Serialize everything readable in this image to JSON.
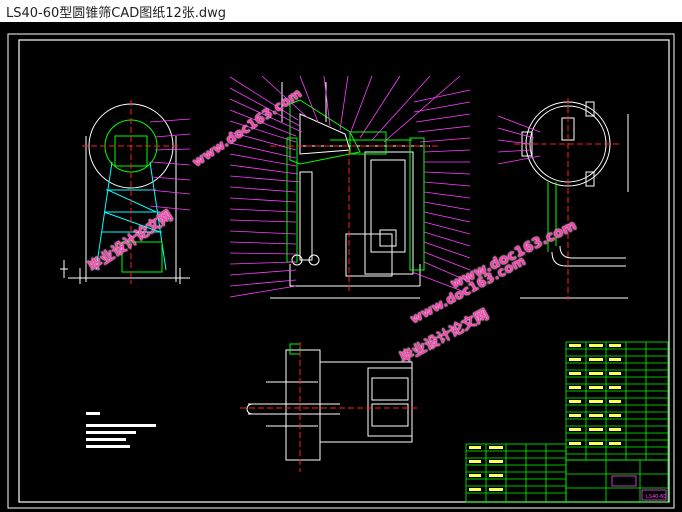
{
  "window": {
    "title": "LS40-60型圆锥筛CAD图纸12张.dwg"
  },
  "watermarks": [
    {
      "text": "www.doc163.com"
    },
    {
      "text": "毕业设计论文网"
    },
    {
      "text": "www.doc163.com"
    },
    {
      "text": "毕业设计论文网"
    },
    {
      "text": "www.doc163.com"
    }
  ],
  "title_block": {
    "drawing_no": "LS40-60"
  },
  "colors": {
    "background": "#000000",
    "frame": "#ffffff",
    "part": "#ffffff",
    "center_line": "#ff2020",
    "leader": "#ff40ff",
    "green": "#00ff00",
    "watermark": "#ff3fb0"
  }
}
